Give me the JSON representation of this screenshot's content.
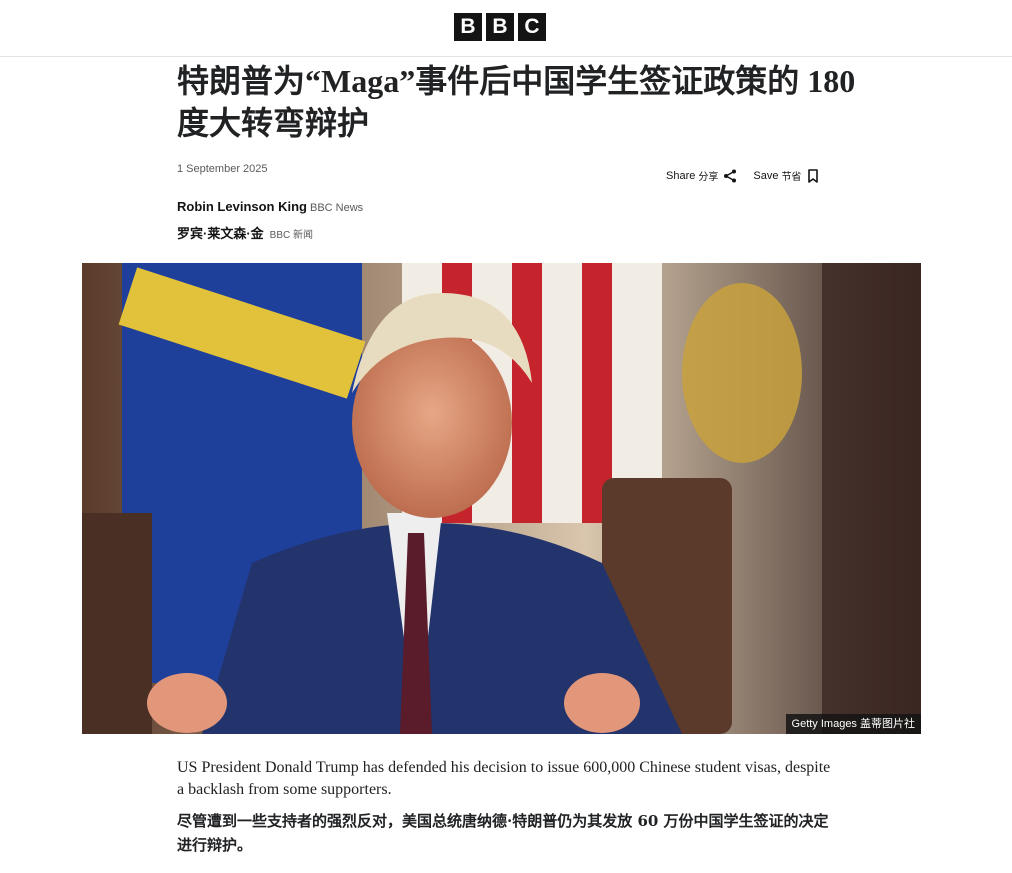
{
  "brand": {
    "logo_letters": [
      "B",
      "B",
      "C"
    ]
  },
  "article": {
    "headline": "特朗普为“Maga”事件后中国学生签证政策的 180 度大转弯辩护",
    "date": "1 September 2025",
    "share": {
      "label": "Share",
      "label_zh": "分享"
    },
    "save": {
      "label": "Save",
      "label_zh": "节省"
    },
    "author": {
      "name": "Robin Levinson King",
      "org": "BBC News"
    },
    "author_zh": {
      "name": "罗宾·莱文森·金",
      "org": "BBC 新闻"
    },
    "image": {
      "credit": "Getty Images 盖蒂图片社"
    },
    "lede": "US President Donald Trump has defended his decision to issue 600,000 Chinese student visas, despite a backlash from some supporters.",
    "lede_zh": "尽管遭到一些支持者的强烈反对，美国总统唐纳德·特朗普仍为其发放 60 万份中国学生签证的决定进行辩护。"
  },
  "icons": {
    "share": "share-icon",
    "save": "bookmark-icon"
  }
}
